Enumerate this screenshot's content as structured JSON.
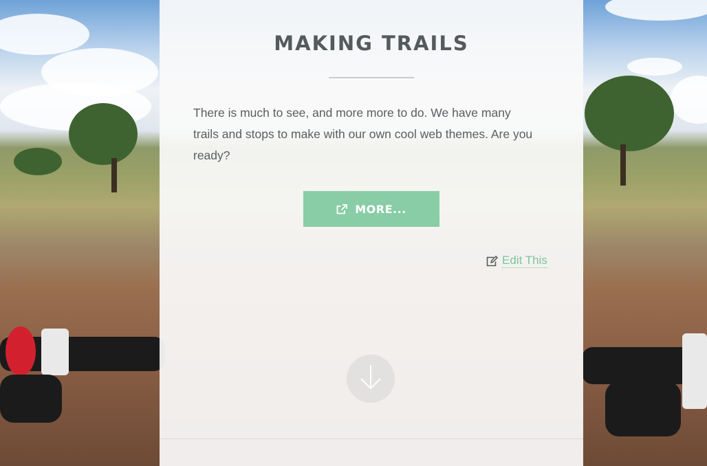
{
  "section": {
    "title": "MAKING TRAILS",
    "body": "There is much to see, and more more to do. We have many trails and stops to make with our own cool web themes. Are you ready?",
    "more_button": {
      "label": "MORE...",
      "icon": "share-icon"
    },
    "edit_link": {
      "label": "Edit This",
      "icon": "edit-icon"
    },
    "scroll_button": {
      "icon": "arrow-down-icon"
    }
  },
  "colors": {
    "accent": "#88cda5",
    "link": "#7cc49a",
    "title_text": "#555a5c",
    "body_text": "#5a5e60"
  }
}
